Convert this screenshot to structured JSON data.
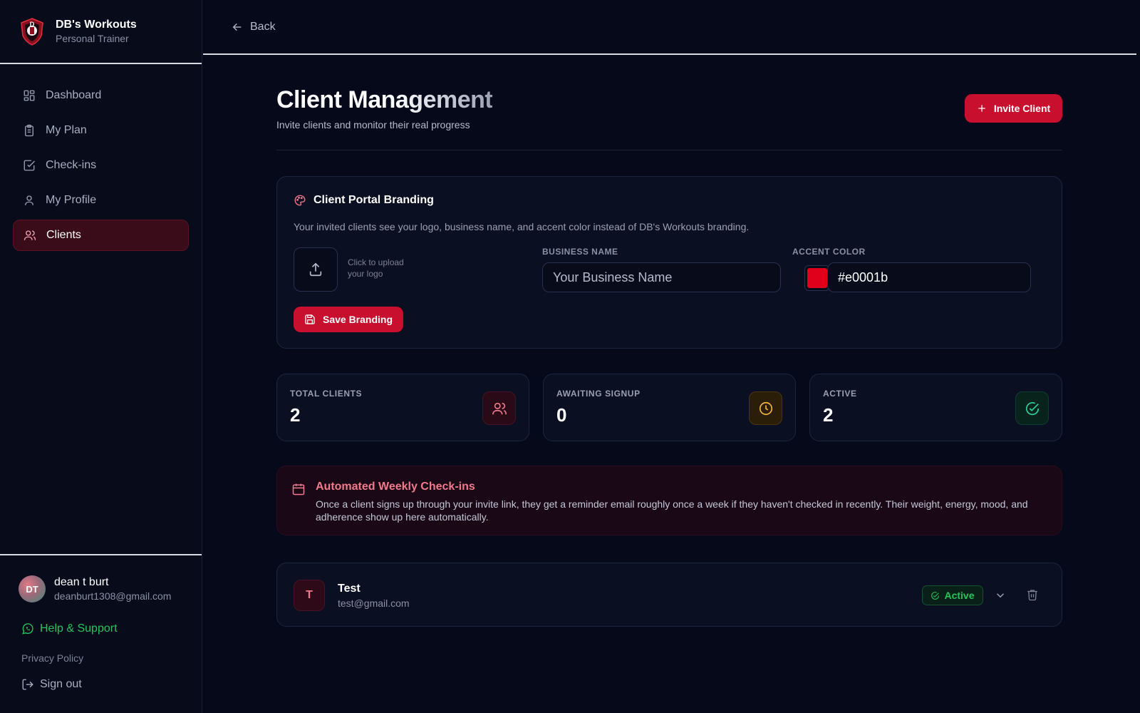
{
  "brand": {
    "name": "DB's Workouts",
    "subtitle": "Personal Trainer",
    "logo_icon": "shield-logo-icon"
  },
  "nav": {
    "items": [
      {
        "label": "Dashboard",
        "icon": "dashboard-icon"
      },
      {
        "label": "My Plan",
        "icon": "clipboard-icon"
      },
      {
        "label": "Check-ins",
        "icon": "check-square-icon"
      },
      {
        "label": "My Profile",
        "icon": "user-icon"
      },
      {
        "label": "Clients",
        "icon": "users-icon",
        "active": true
      }
    ]
  },
  "user": {
    "initials": "DT",
    "name": "dean t burt",
    "email": "deanburt1308@gmail.com"
  },
  "footer": {
    "help_label": "Help & Support",
    "privacy_label": "Privacy Policy",
    "signout_label": "Sign out"
  },
  "topbar": {
    "back_label": "Back"
  },
  "header": {
    "title": "Client Management",
    "subtitle": "Invite clients and monitor their real progress",
    "invite_label": "Invite Client"
  },
  "branding": {
    "title": "Client Portal Branding",
    "description": "Your invited clients see your logo, business name, and accent color instead of DB's Workouts branding.",
    "upload_hint": "Click to upload your logo",
    "business_name_label": "BUSINESS NAME",
    "business_name_placeholder": "Your Business Name",
    "business_name_value": "",
    "accent_color_label": "ACCENT COLOR",
    "accent_color_value": "#e0001b",
    "save_label": "Save Branding"
  },
  "stats": [
    {
      "label": "TOTAL CLIENTS",
      "value": "2",
      "icon": "users-icon",
      "color": "#f07a8c"
    },
    {
      "label": "AWAITING SIGNUP",
      "value": "0",
      "icon": "clock-icon",
      "color": "#f5b53d"
    },
    {
      "label": "ACTIVE",
      "value": "2",
      "icon": "check-circle-icon",
      "color": "#2dd4a0"
    }
  ],
  "notice": {
    "title": "Automated Weekly Check-ins",
    "text": "Once a client signs up through your invite link, they get a reminder email roughly once a week if they haven't checked in recently. Their weight, energy, mood, and adherence show up here automatically."
  },
  "clients": [
    {
      "initial": "T",
      "name": "Test",
      "email": "test@gmail.com",
      "status": "Active"
    }
  ],
  "colors": {
    "accent": "#c8102e",
    "background": "#05091a",
    "success": "#22c55e"
  }
}
